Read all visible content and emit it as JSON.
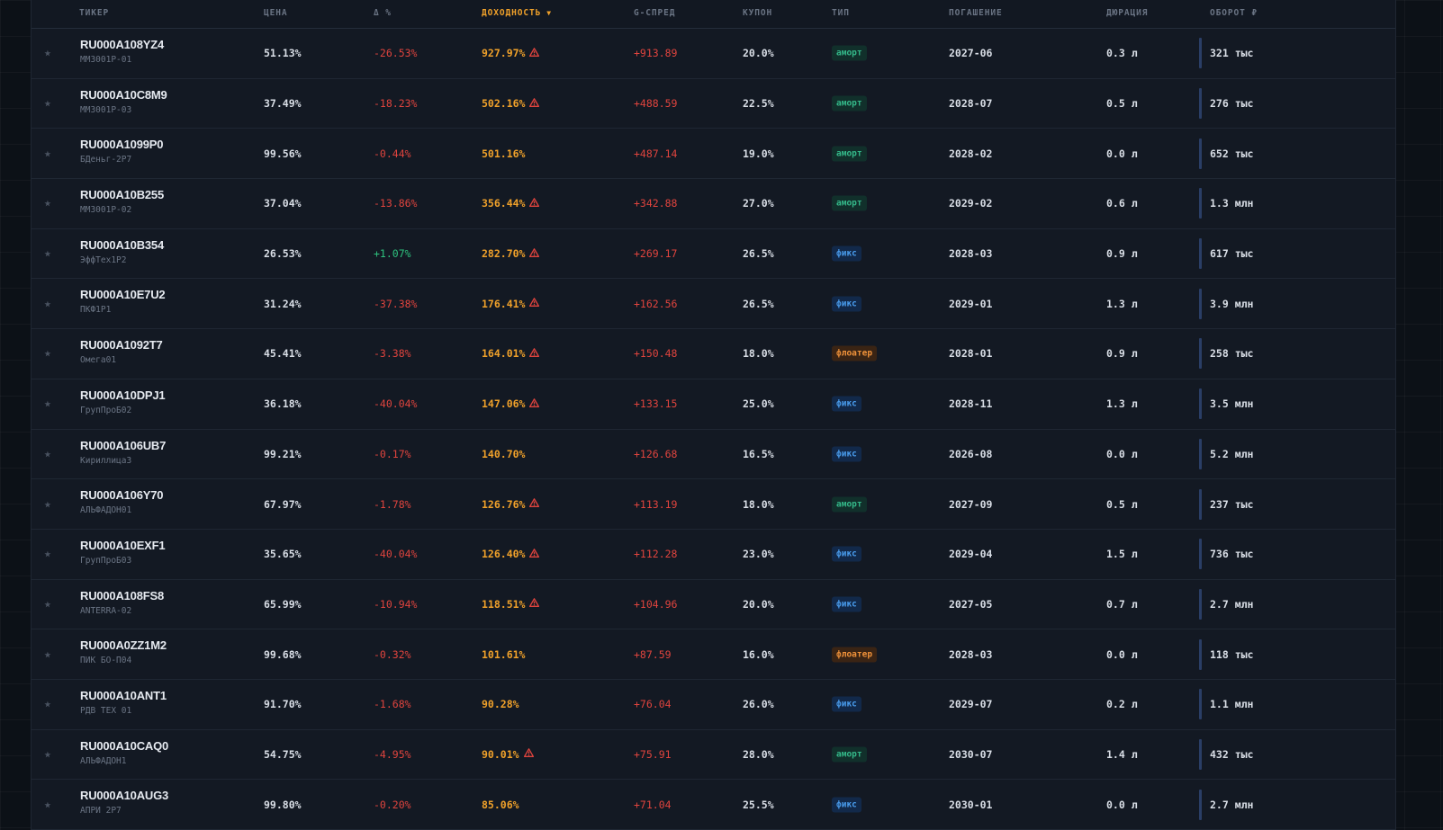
{
  "columns": {
    "ticker": "ТИКЕР",
    "price": "ЦЕНА",
    "change": "Δ %",
    "yield": "ДОХОДНОСТЬ",
    "yield_sort": "▼",
    "gspread": "G-СПРЕД",
    "coupon": "КУПОН",
    "type": "ТИП",
    "maturity": "ПОГАШЕНИЕ",
    "duration": "ДЮРАЦИЯ",
    "turnover": "ОБОРОТ ₽"
  },
  "colors": {
    "negative": "#e0443e",
    "positive": "#2ec27e",
    "yield": "#f0a12a",
    "amort": "#34b889",
    "fix": "#4a9ef0",
    "float": "#f0923a"
  },
  "rows": [
    {
      "ticker": "RU000A108YZ4",
      "name": "ММЗ001Р-01",
      "price": "51.13%",
      "change": "-26.53%",
      "change_dir": "neg",
      "yield": "927.97%",
      "warn": true,
      "gspread": "+913.89",
      "coupon": "20.0%",
      "type": "аморт",
      "type_kind": "amort",
      "maturity": "2027-06",
      "duration": "0.3 л",
      "turnover": "321 тыс"
    },
    {
      "ticker": "RU000A10C8M9",
      "name": "ММЗ001Р-03",
      "price": "37.49%",
      "change": "-18.23%",
      "change_dir": "neg",
      "yield": "502.16%",
      "warn": true,
      "gspread": "+488.59",
      "coupon": "22.5%",
      "type": "аморт",
      "type_kind": "amort",
      "maturity": "2028-07",
      "duration": "0.5 л",
      "turnover": "276 тыс"
    },
    {
      "ticker": "RU000A1099P0",
      "name": "БДеньг-2Р7",
      "price": "99.56%",
      "change": "-0.44%",
      "change_dir": "neg",
      "yield": "501.16%",
      "warn": false,
      "gspread": "+487.14",
      "coupon": "19.0%",
      "type": "аморт",
      "type_kind": "amort",
      "maturity": "2028-02",
      "duration": "0.0 л",
      "turnover": "652 тыс"
    },
    {
      "ticker": "RU000A10B255",
      "name": "ММЗ001Р-02",
      "price": "37.04%",
      "change": "-13.86%",
      "change_dir": "neg",
      "yield": "356.44%",
      "warn": true,
      "gspread": "+342.88",
      "coupon": "27.0%",
      "type": "аморт",
      "type_kind": "amort",
      "maturity": "2029-02",
      "duration": "0.6 л",
      "turnover": "1.3 млн"
    },
    {
      "ticker": "RU000A10B354",
      "name": "ЭффТех1Р2",
      "price": "26.53%",
      "change": "+1.07%",
      "change_dir": "pos",
      "yield": "282.70%",
      "warn": true,
      "gspread": "+269.17",
      "coupon": "26.5%",
      "type": "фикс",
      "type_kind": "fix",
      "maturity": "2028-03",
      "duration": "0.9 л",
      "turnover": "617 тыс"
    },
    {
      "ticker": "RU000A10E7U2",
      "name": "ПКФ1Р1",
      "price": "31.24%",
      "change": "-37.38%",
      "change_dir": "neg",
      "yield": "176.41%",
      "warn": true,
      "gspread": "+162.56",
      "coupon": "26.5%",
      "type": "фикс",
      "type_kind": "fix",
      "maturity": "2029-01",
      "duration": "1.3 л",
      "turnover": "3.9 млн"
    },
    {
      "ticker": "RU000A1092T7",
      "name": "Омега01",
      "price": "45.41%",
      "change": "-3.38%",
      "change_dir": "neg",
      "yield": "164.01%",
      "warn": true,
      "gspread": "+150.48",
      "coupon": "18.0%",
      "type": "флоатер",
      "type_kind": "float",
      "maturity": "2028-01",
      "duration": "0.9 л",
      "turnover": "258 тыс"
    },
    {
      "ticker": "RU000A10DPJ1",
      "name": "ГрупПроБ02",
      "price": "36.18%",
      "change": "-40.04%",
      "change_dir": "neg",
      "yield": "147.06%",
      "warn": true,
      "gspread": "+133.15",
      "coupon": "25.0%",
      "type": "фикс",
      "type_kind": "fix",
      "maturity": "2028-11",
      "duration": "1.3 л",
      "turnover": "3.5 млн"
    },
    {
      "ticker": "RU000A106UB7",
      "name": "Кириллица3",
      "price": "99.21%",
      "change": "-0.17%",
      "change_dir": "neg",
      "yield": "140.70%",
      "warn": false,
      "gspread": "+126.68",
      "coupon": "16.5%",
      "type": "фикс",
      "type_kind": "fix",
      "maturity": "2026-08",
      "duration": "0.0 л",
      "turnover": "5.2 млн"
    },
    {
      "ticker": "RU000A106Y70",
      "name": "АЛЬФАДОН01",
      "price": "67.97%",
      "change": "-1.78%",
      "change_dir": "neg",
      "yield": "126.76%",
      "warn": true,
      "gspread": "+113.19",
      "coupon": "18.0%",
      "type": "аморт",
      "type_kind": "amort",
      "maturity": "2027-09",
      "duration": "0.5 л",
      "turnover": "237 тыс"
    },
    {
      "ticker": "RU000A10EXF1",
      "name": "ГрупПроБ03",
      "price": "35.65%",
      "change": "-40.04%",
      "change_dir": "neg",
      "yield": "126.40%",
      "warn": true,
      "gspread": "+112.28",
      "coupon": "23.0%",
      "type": "фикс",
      "type_kind": "fix",
      "maturity": "2029-04",
      "duration": "1.5 л",
      "turnover": "736 тыс"
    },
    {
      "ticker": "RU000A108FS8",
      "name": "ANTERRA-02",
      "price": "65.99%",
      "change": "-10.94%",
      "change_dir": "neg",
      "yield": "118.51%",
      "warn": true,
      "gspread": "+104.96",
      "coupon": "20.0%",
      "type": "фикс",
      "type_kind": "fix",
      "maturity": "2027-05",
      "duration": "0.7 л",
      "turnover": "2.7 млн"
    },
    {
      "ticker": "RU000A0ZZ1M2",
      "name": "ПИК БО-П04",
      "price": "99.68%",
      "change": "-0.32%",
      "change_dir": "neg",
      "yield": "101.61%",
      "warn": false,
      "gspread": "+87.59",
      "coupon": "16.0%",
      "type": "флоатер",
      "type_kind": "float",
      "maturity": "2028-03",
      "duration": "0.0 л",
      "turnover": "118 тыс"
    },
    {
      "ticker": "RU000A10ANT1",
      "name": "РДВ ТЕХ 01",
      "price": "91.70%",
      "change": "-1.68%",
      "change_dir": "neg",
      "yield": "90.28%",
      "warn": false,
      "gspread": "+76.04",
      "coupon": "26.0%",
      "type": "фикс",
      "type_kind": "fix",
      "maturity": "2029-07",
      "duration": "0.2 л",
      "turnover": "1.1 млн"
    },
    {
      "ticker": "RU000A10CAQ0",
      "name": "АЛЬФАДОН1",
      "price": "54.75%",
      "change": "-4.95%",
      "change_dir": "neg",
      "yield": "90.01%",
      "warn": true,
      "gspread": "+75.91",
      "coupon": "28.0%",
      "type": "аморт",
      "type_kind": "amort",
      "maturity": "2030-07",
      "duration": "1.4 л",
      "turnover": "432 тыс"
    },
    {
      "ticker": "RU000A10AUG3",
      "name": "АПРИ 2Р7",
      "price": "99.80%",
      "change": "-0.20%",
      "change_dir": "neg",
      "yield": "85.06%",
      "warn": false,
      "gspread": "+71.04",
      "coupon": "25.5%",
      "type": "фикс",
      "type_kind": "fix",
      "maturity": "2030-01",
      "duration": "0.0 л",
      "turnover": "2.7 млн"
    }
  ]
}
